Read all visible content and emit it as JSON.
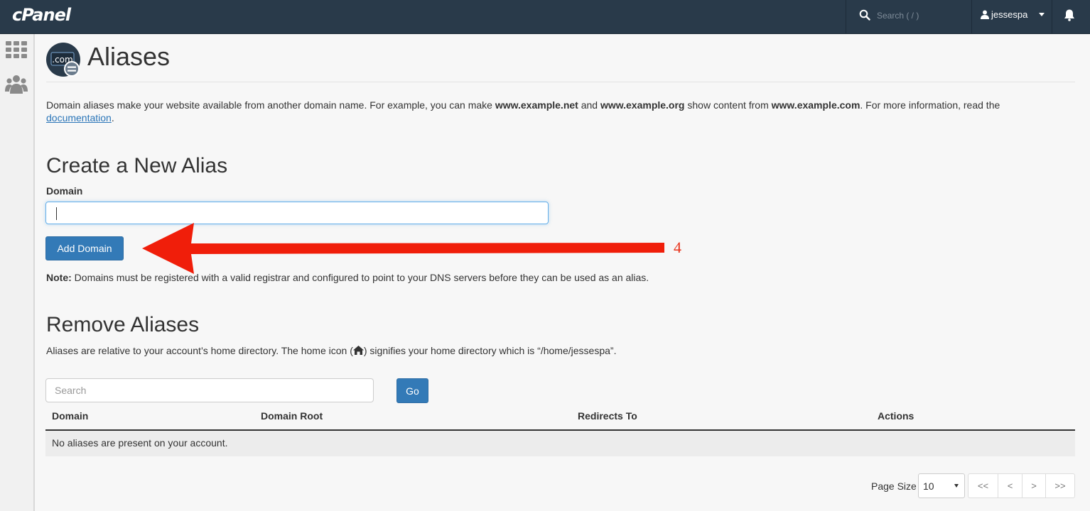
{
  "topbar": {
    "logo": "cPanel",
    "search_placeholder": "Search ( / )",
    "username": "jessespa"
  },
  "page": {
    "title": "Aliases",
    "icon_text": ".com",
    "description": {
      "part1": "Domain aliases make your website available from another domain name. For example, you can make ",
      "ex_net": "www.example.net",
      "and": " and ",
      "ex_org": "www.example.org",
      "part2": " show content from ",
      "ex_com": "www.example.com",
      "part3": ". For more information, read the ",
      "link": "documentation",
      "end": "."
    }
  },
  "create": {
    "heading": "Create a New Alias",
    "domain_label": "Domain",
    "domain_value": "",
    "add_button": "Add Domain",
    "note_label": "Note:",
    "note_text": " Domains must be registered with a valid registrar and configured to point to your DNS servers before they can be used as an alias."
  },
  "remove": {
    "heading": "Remove Aliases",
    "desc_pre": "Aliases are relative to your account’s home directory. The home icon (",
    "desc_post": ") signifies your home directory which is “/home/jessespa”.",
    "search_placeholder": "Search",
    "go_button": "Go",
    "columns": [
      "Domain",
      "Domain Root",
      "Redirects To",
      "Actions"
    ],
    "empty_message": "No aliases are present on your account."
  },
  "pagination": {
    "page_size_label": "Page Size",
    "page_size": "10",
    "first": "<<",
    "prev": "<",
    "next": ">",
    "last": ">>"
  },
  "annotation": {
    "step_number": "4",
    "color": "#e8321a"
  }
}
